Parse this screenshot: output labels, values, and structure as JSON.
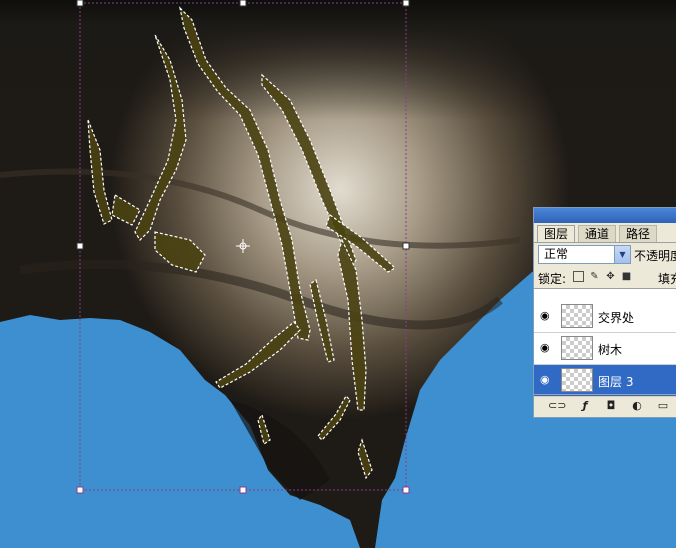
{
  "colors": {
    "sky": "#3d8fcf",
    "rock_dark": "#141414",
    "rock_light": "#cfc8bb",
    "selection_fill": "#4a4212",
    "transform_box": "#8a3c8a",
    "selected_layer": "#316ac5"
  },
  "layers_panel": {
    "tabs": [
      "图层",
      "通道",
      "路径"
    ],
    "active_tab": "图层",
    "blend_mode": "正常",
    "opacity_label": "不透明度",
    "lock_label": "锁定:",
    "fill_label": "填充",
    "lock_icons": [
      "lock-transparent-icon",
      "brush-icon",
      "move-icon",
      "lock-icon"
    ],
    "layers": [
      {
        "name": "交界处",
        "visible": true,
        "selected": false
      },
      {
        "name": "树木",
        "visible": true,
        "selected": false
      },
      {
        "name": "图层 3",
        "visible": true,
        "selected": true
      }
    ],
    "footer_icons": [
      "link-icon",
      "fx-icon",
      "mask-icon",
      "adjustment-icon",
      "folder-icon"
    ]
  }
}
